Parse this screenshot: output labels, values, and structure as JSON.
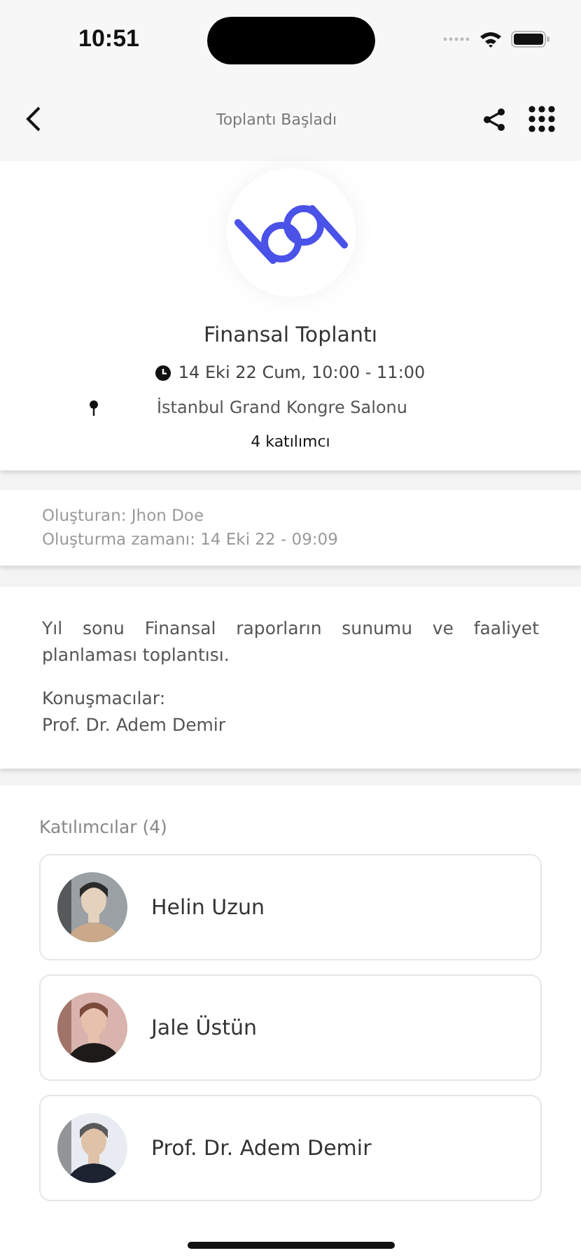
{
  "status_bar": {
    "time": "10:51"
  },
  "nav": {
    "title": "Toplantı Başladı"
  },
  "meeting": {
    "title": "Finansal Toplantı",
    "datetime": "14 Eki 22 Cum, 10:00 - 11:00",
    "location": "İstanbul Grand Kongre Salonu",
    "attendee_count": "4 katılımcı"
  },
  "creator": {
    "created_by": "Oluşturan: Jhon Doe",
    "created_at": "Oluşturma zamanı: 14 Eki 22 - 09:09"
  },
  "description": {
    "text": "Yıl sonu Finansal raporların sunumu ve faaliyet planlaması toplantısı.",
    "speakers_label": "Konuşmacılar:",
    "speakers": "Prof. Dr. Adem Demir"
  },
  "participants": {
    "heading": "Katılımcılar (4)",
    "items": [
      {
        "name": "Helin Uzun"
      },
      {
        "name": "Jale Üstün"
      },
      {
        "name": "Prof. Dr. Adem Demir"
      }
    ]
  }
}
